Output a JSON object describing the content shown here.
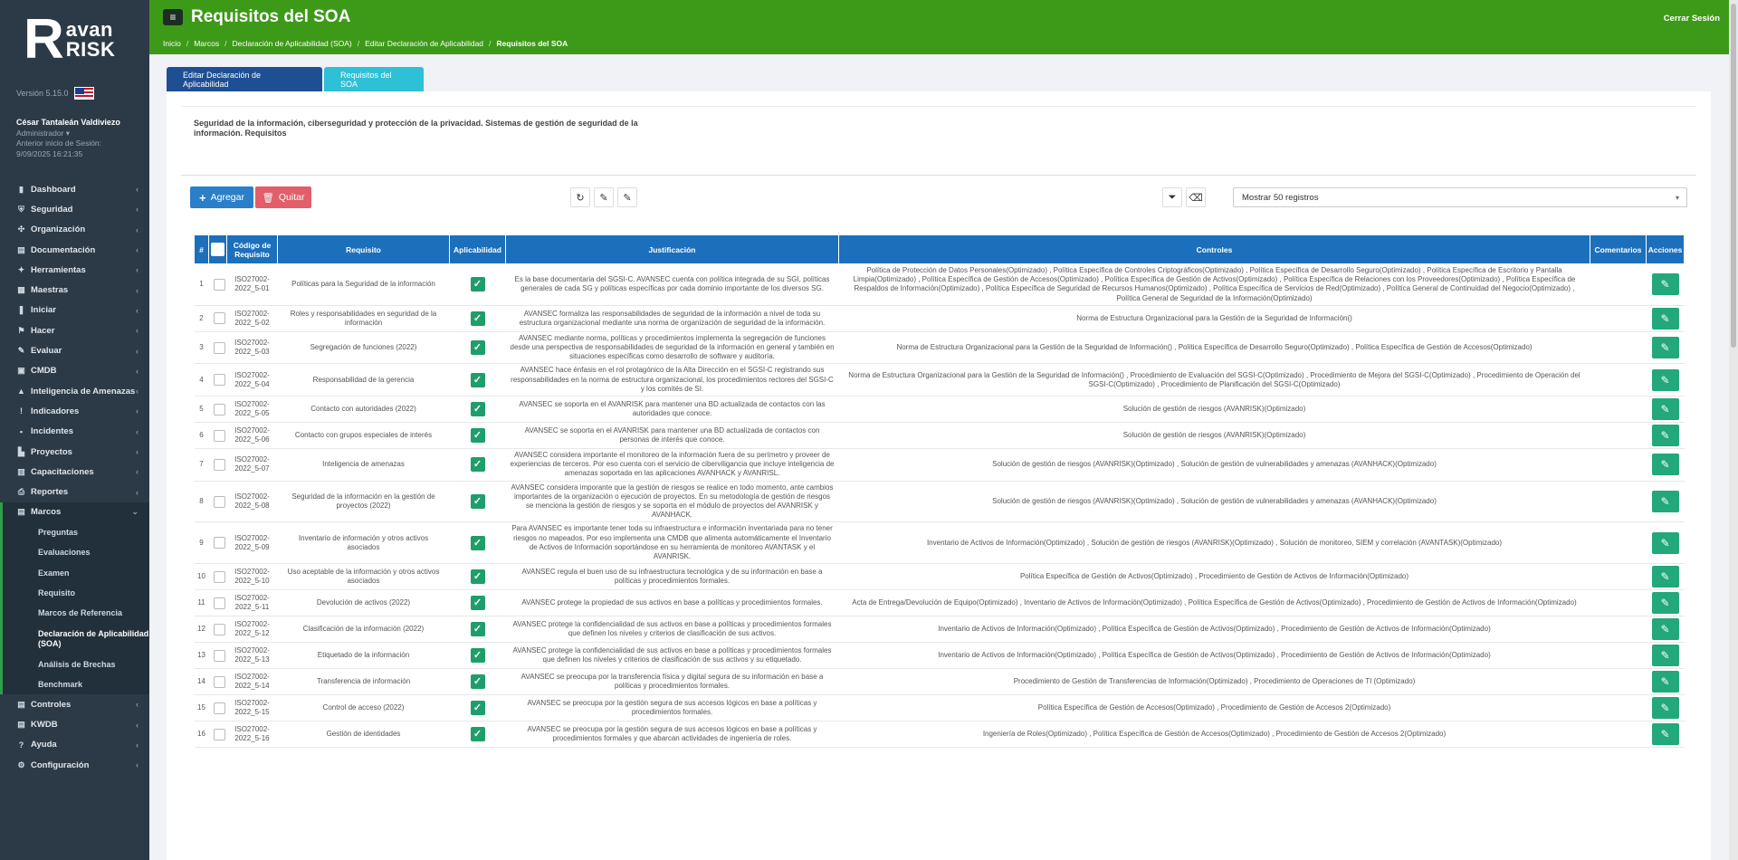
{
  "brand": {
    "letter": "R",
    "line1": "avan",
    "line2": "RISK"
  },
  "version": "Versión 5.15.0",
  "user": {
    "name": "César Tantaleán Valdiviezo",
    "role": "Administrador ▾",
    "last_label": "Anterior inicio de Sesión:",
    "last_value": "9/09/2025 16:21:35"
  },
  "menu": [
    {
      "label": "Dashboard",
      "icon": "▮"
    },
    {
      "label": "Seguridad",
      "icon": "⛨"
    },
    {
      "label": "Organización",
      "icon": "✣"
    },
    {
      "label": "Documentación",
      "icon": "▤"
    },
    {
      "label": "Herramientas",
      "icon": "✦"
    },
    {
      "label": "Maestras",
      "icon": "▦"
    },
    {
      "label": "Iniciar",
      "icon": "❚"
    },
    {
      "label": "Hacer",
      "icon": "⚑"
    },
    {
      "label": "Evaluar",
      "icon": "✎"
    },
    {
      "label": "CMDB",
      "icon": "▣"
    },
    {
      "label": "Inteligencia de Amenazas",
      "icon": "▲"
    },
    {
      "label": "Indicadores",
      "icon": "!"
    },
    {
      "label": "Incidentes",
      "icon": "▪"
    },
    {
      "label": "Proyectos",
      "icon": "▙"
    },
    {
      "label": "Capacitaciones",
      "icon": "▥"
    },
    {
      "label": "Reportes",
      "icon": "⎙"
    }
  ],
  "marcos": {
    "label": "Marcos",
    "icon": "▤"
  },
  "submenu": [
    "Preguntas",
    "Evaluaciones",
    "Examen",
    "Requisito",
    "Marcos de Referencia",
    "Declaración de Aplicabilidad (SOA)",
    "Análisis de Brechas",
    "Benchmark"
  ],
  "menu_after": [
    {
      "label": "Controles",
      "icon": "▤"
    },
    {
      "label": "KWDB",
      "icon": "▤"
    },
    {
      "label": "Ayuda",
      "icon": "?"
    },
    {
      "label": "Configuración",
      "icon": "⚙"
    }
  ],
  "header": {
    "title": "Requisitos del SOA",
    "logout": "Cerrar Sesión",
    "breadcrumb": [
      "Inicio",
      "Marcos",
      "Declaración de Aplicabilidad (SOA)",
      "Editar Declaración de Aplicabilidad",
      "Requisitos del SOA"
    ]
  },
  "tabs": [
    "Editar Declaración de Aplicabilidad",
    "Requisitos del SOA"
  ],
  "description": "Seguridad de la información, ciberseguridad y protección de la privacidad. Sistemas de gestión de seguridad de la información. Requisitos",
  "toolbar": {
    "add": "Agregar",
    "remove": "Quitar",
    "page_size": "Mostrar 50 registros"
  },
  "columns": [
    "#",
    "",
    "Código de Requisito",
    "Requisito",
    "Aplicabilidad",
    "Justificación",
    "Controles",
    "Comentarios",
    "Acciones"
  ],
  "rows": [
    {
      "n": "1",
      "code": "ISO27002-2022_5-01",
      "req": "Políticas para la Seguridad de la información",
      "just": "Es la base documentaria del SGSI-C. AVANSEC cuenta con política integrada de su SGI, políticas generales de cada SG y políticas específicas por cada dominio importante de los diversos SG.",
      "ctrl": "Política de Protección de Datos Personales(Optimizado) , Política Específica de Controles Criptográficos(Optimizado) , Política Específica de Desarrollo Seguro(Optimizado) , Política Específica de Escritorio y Pantalla Limpia(Optimizado) , Política Específica de Gestión de Accesos(Optimizado) , Política Específica de Gestión de Activos(Optimizado) , Política Específica de Relaciones con los Proveedores(Optimizado) , Política Específica de Respaldos de Información(Optimizado) , Política Específica de Seguridad de Recursos Humanos(Optimizado) , Política Específica de Servicios de Red(Optimizado) , Política General de Continuidad del Negocio(Optimizado) , Política General de Seguridad de la Información(Optimizado)"
    },
    {
      "n": "2",
      "code": "ISO27002-2022_5-02",
      "req": "Roles y responsabilidades en seguridad de la información",
      "just": "AVANSEC formaliza las responsabilidades de seguridad de la información a nivel de toda su estructura organizacional mediante una norma de organización de seguridad de la información.",
      "ctrl": "Norma de Estructura Organizacional para la Gestión de la Seguridad de Información()"
    },
    {
      "n": "3",
      "code": "ISO27002-2022_5-03",
      "req": "Segregación de funciones (2022)",
      "just": "AVANSEC mediante norma, políticas y procedimientos implementa la segregación de funciones desde una perspectiva de responsabilidades de seguridad de la información en general y también en situaciones específicas como desarrollo de software y auditoría.",
      "ctrl": "Norma de Estructura Organizacional para la Gestión de la Seguridad de Información() , Política Específica de Desarrollo Seguro(Optimizado) , Política Específica de Gestión de Accesos(Optimizado)"
    },
    {
      "n": "4",
      "code": "ISO27002-2022_5-04",
      "req": "Responsabilidad de la gerencia",
      "just": "AVANSEC hace énfasis en el rol protagónico de la Alta Dirección en el SGSI-C registrando sus responsabilidades en la norma de estructura organizacional, los procedimientos rectores del SGSI-C y los comités de SI.",
      "ctrl": "Norma de Estructura Organizacional para la Gestión de la Seguridad de Información() , Procedimiento de Evaluación del SGSI-C(Optimizado) , Procedimiento de Mejora del SGSI-C(Optimizado) , Procedimiento de Operación del SGSI-C(Optimizado) , Procedimiento de Planificación del SGSI-C(Optimizado)"
    },
    {
      "n": "5",
      "code": "ISO27002-2022_5-05",
      "req": "Contacto con autoridades (2022)",
      "just": "AVANSEC se soporta en el AVANRISK para mantener una BD actualizada de contactos con las autoridades que conoce.",
      "ctrl": "Solución de gestión de riesgos (AVANRISK)(Optimizado)"
    },
    {
      "n": "6",
      "code": "ISO27002-2022_5-06",
      "req": "Contacto con grupos especiales de interés",
      "just": "AVANSEC se soporta en el AVANRISK para mantener una BD actualizada de contactos con personas de interés que conoce.",
      "ctrl": "Solución de gestión de riesgos (AVANRISK)(Optimizado)"
    },
    {
      "n": "7",
      "code": "ISO27002-2022_5-07",
      "req": "Inteligencia de amenazas",
      "just": "AVANSEC considera importante el monitoreo de la información fuera de su perímetro y proveer de experiencias de terceros. Por eso cuenta con el servicio de ciberviligancia que incluye inteligencia de amenazas soportada en las aplicaciones AVANHACK y AVANRISL.",
      "ctrl": "Solución de gestión de riesgos (AVANRISK)(Optimizado) , Solución de gestión de vulnerabilidades y amenazas (AVANHACK)(Optimizado)"
    },
    {
      "n": "8",
      "code": "ISO27002-2022_5-08",
      "req": "Seguridad de la información en la gestión de proyectos (2022)",
      "just": "AVANSEC considera imporante que la gestión de riesgos se realice en todo momento, ante cambios importantes de la organización o ejecución de proyectos. En su metodología de gestión de riesgos se menciona la gestión de riesgos y se soporta en el módulo de proyectos del AVANRISK y AVANHACK.",
      "ctrl": "Solución de gestión de riesgos (AVANRISK)(Optimizado) , Solución de gestión de vulnerabilidades y amenazas (AVANHACK)(Optimizado)"
    },
    {
      "n": "9",
      "code": "ISO27002-2022_5-09",
      "req": "Inventario de información y otros activos asociados",
      "just": "Para AVANSEC es importante tener toda su infraestructura e información inventariada para no tener riesgos no mapeados. Por eso implementa una CMDB que alimenta automáticamente el Inventario de Activos de Información soportándose en su herramienta de monitoreo AVANTASK y el AVANRISK.",
      "ctrl": "Inventario de Activos de Información(Optimizado) , Solución de gestión de riesgos (AVANRISK)(Optimizado) , Solución de monitoreo, SIEM y correlación (AVANTASK)(Optimizado)"
    },
    {
      "n": "10",
      "code": "ISO27002-2022_5-10",
      "req": "Uso aceptable de la información y otros activos asociados",
      "just": "AVANSEC regula el buen uso de su infraestructura tecnológica y de su información en base a políticas y procedimientos formales.",
      "ctrl": "Política Específica de Gestión de Activos(Optimizado) , Procedimiento de Gestión de Activos de Información(Optimizado)"
    },
    {
      "n": "11",
      "code": "ISO27002-2022_5-11",
      "req": "Devolución de activos (2022)",
      "just": "AVANSEC protege la propiedad de sus activos en base a políticas y procedimientos formales.",
      "ctrl": "Acta de Entrega/Devolución de Equipo(Optimizado) , Inventario de Activos de Información(Optimizado) , Política Específica de Gestión de Activos(Optimizado) , Procedimiento de Gestión de Activos de Información(Optimizado)"
    },
    {
      "n": "12",
      "code": "ISO27002-2022_5-12",
      "req": "Clasificación de la información (2022)",
      "just": "AVANSEC protege la confidencialidad de sus activos en base a políticas y procedimientos formales que definen los niveles y criterios de clasificación de sus activos.",
      "ctrl": "Inventario de Activos de Información(Optimizado) , Política Específica de Gestión de Activos(Optimizado) , Procedimiento de Gestión de Activos de Información(Optimizado)"
    },
    {
      "n": "13",
      "code": "ISO27002-2022_5-13",
      "req": "Etiquetado de la información",
      "just": "AVANSEC protege la confidencialidad de sus activos en base a políticas y procedimientos formales que definen los niveles y criterios de clasificación de sus activos y su etiquetado.",
      "ctrl": "Inventario de Activos de Información(Optimizado) , Política Específica de Gestión de Activos(Optimizado) , Procedimiento de Gestión de Activos de Información(Optimizado)"
    },
    {
      "n": "14",
      "code": "ISO27002-2022_5-14",
      "req": "Transferencia de información",
      "just": "AVANSEC se preocupa por la transferencia física y digital segura de su información en base a políticas y procedimientos formales.",
      "ctrl": "Procedimiento de Gestión de Transferencias de Información(Optimizado) , Procedimiento de Operaciones de TI (Optimizado)"
    },
    {
      "n": "15",
      "code": "ISO27002-2022_5-15",
      "req": "Control de acceso (2022)",
      "just": "AVANSEC se preocupa por la gestión segura de sus accesos lógicos en base a políticas y procedimientos formales.",
      "ctrl": "Política Específica de Gestión de Accesos(Optimizado) , Procedimiento de Gestión de Accesos 2(Optimizado)"
    },
    {
      "n": "16",
      "code": "ISO27002-2022_5-16",
      "req": "Gestión de identidades",
      "just": "AVANSEC se preocupa por la gestión segura de sus accesos lógicos en base a políticas y procedimientos formales y que abarcan actividades de ingeniería de roles.",
      "ctrl": "Ingeniería de Roles(Optimizado) , Política Específica de Gestión de Accesos(Optimizado) , Procedimiento de Gestión de Accesos 2(Optimizado)"
    }
  ]
}
